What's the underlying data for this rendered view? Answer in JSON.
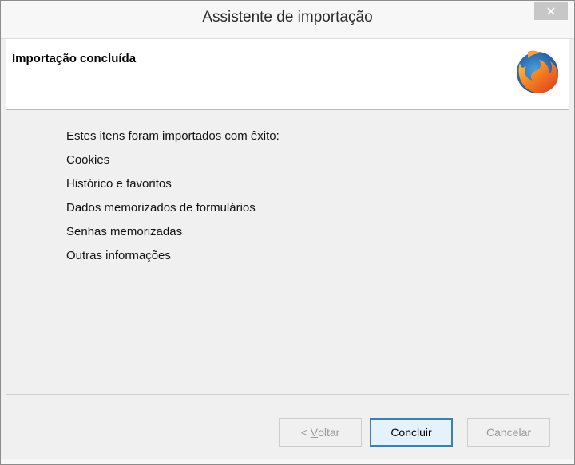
{
  "window": {
    "title": "Assistente de importação"
  },
  "header": {
    "title": "Importação concluída",
    "logo": "firefox-logo"
  },
  "content": {
    "intro": "Estes itens foram importados com êxito:",
    "items": [
      "Cookies",
      "Histórico e favoritos",
      "Dados memorizados de formulários",
      "Senhas memorizadas",
      "Outras informações"
    ]
  },
  "buttons": {
    "back_prefix": "< ",
    "back_accel": "V",
    "back_rest": "oltar",
    "finish": "Concluir",
    "cancel": "Cancelar"
  },
  "colors": {
    "default_button_border": "#3c7fb1",
    "close_button_bg": "#c7c7c7"
  }
}
